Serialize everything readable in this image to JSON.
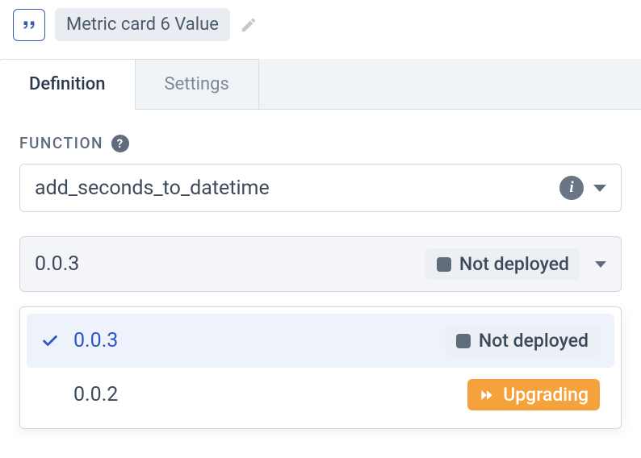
{
  "header": {
    "title_chip": "Metric card 6 Value"
  },
  "tabs": {
    "definition": "Definition",
    "settings": "Settings"
  },
  "function": {
    "section_label": "FUNCTION",
    "name": "add_seconds_to_datetime"
  },
  "version": {
    "selected": "0.0.3",
    "selected_badge": "Not deployed",
    "options": [
      {
        "label": "0.0.3",
        "badge_text": "Not deployed",
        "badge_kind": "light",
        "selected": true
      },
      {
        "label": "0.0.2",
        "badge_text": "Upgrading",
        "badge_kind": "orange",
        "selected": false
      }
    ]
  }
}
